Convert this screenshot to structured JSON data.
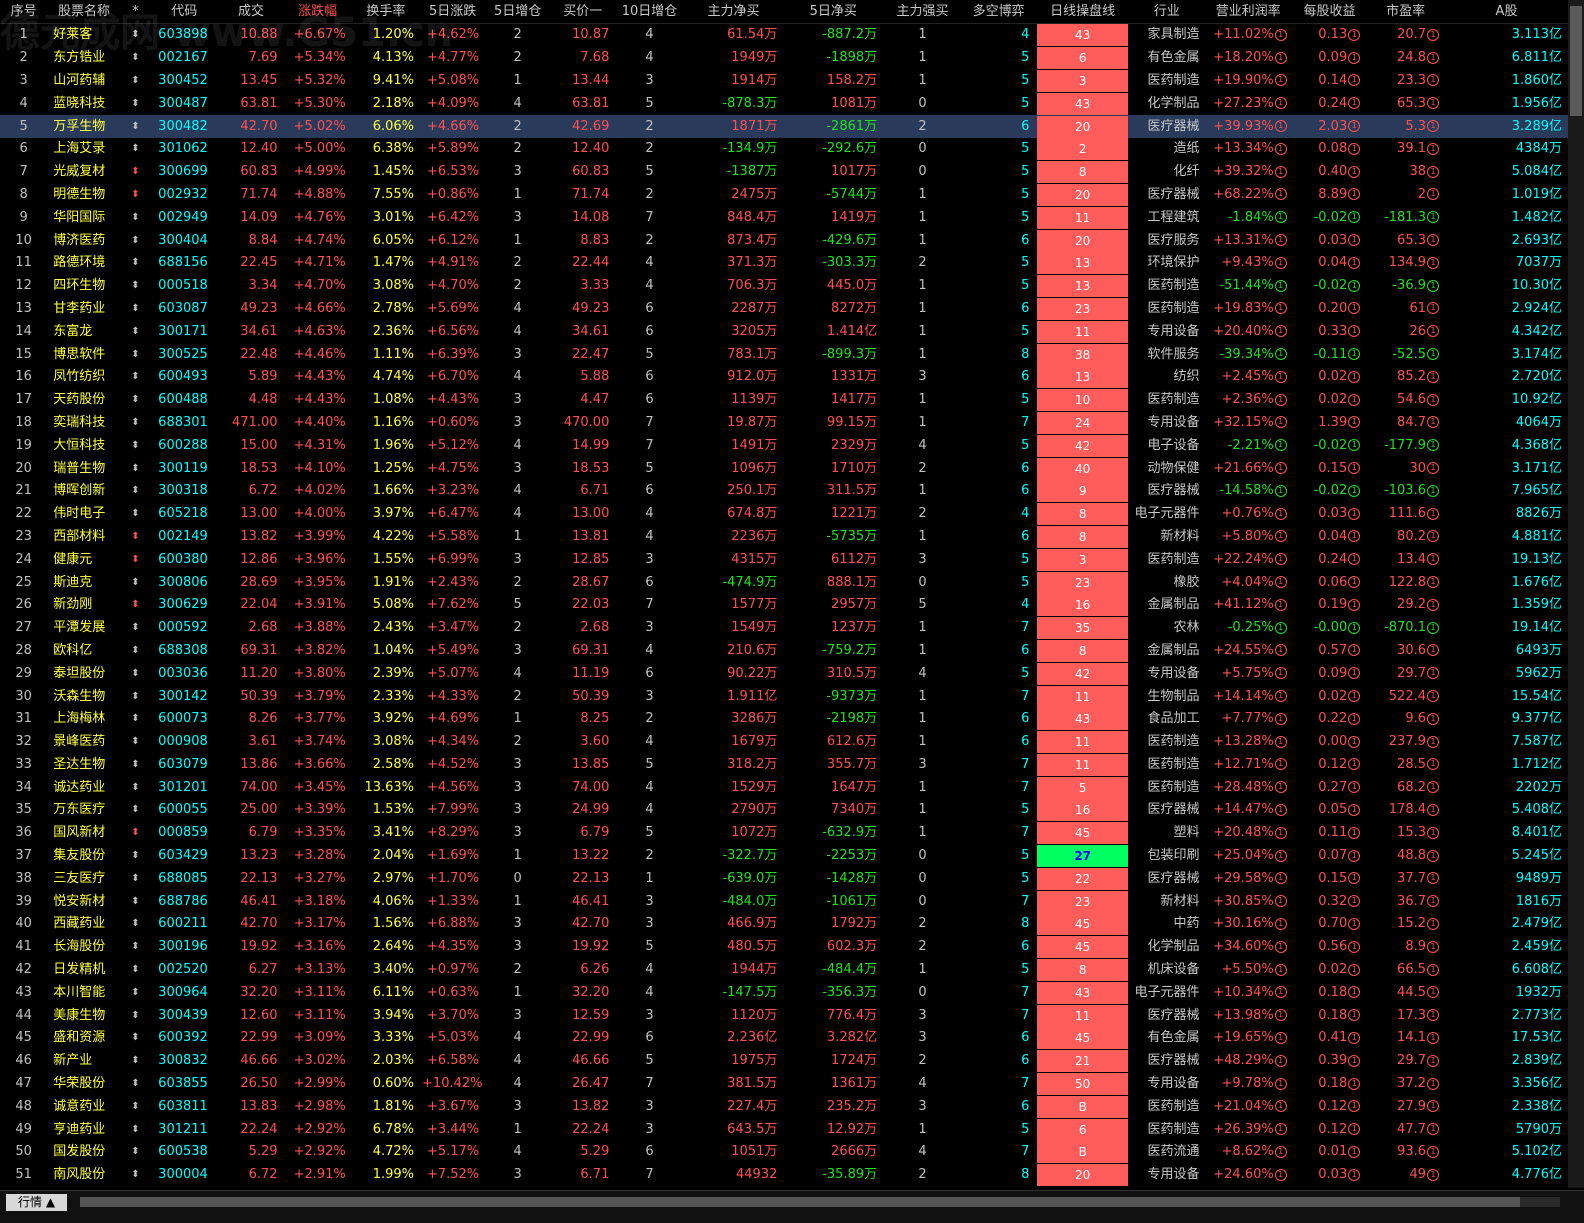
{
  "headers": [
    "序号",
    "股票名称",
    "*",
    "代码",
    "成交",
    "涨跌幅",
    "换手率",
    "5日涨跌",
    "5日增仓",
    "买价一",
    "10日增仓",
    "主力净买",
    "5日净买",
    "主力强买",
    "多空博弈",
    "日线操盘线",
    "行业",
    "营业利润率",
    "每股收益",
    "市盈率",
    "A股"
  ],
  "watermark": "德元成网 www.G51.cn",
  "bottom_tab": "行情 ▲",
  "circle_mark": "①",
  "rows": [
    [
      "1",
      "好莱客",
      "⬍",
      "603898",
      "10.88",
      "+6.67%",
      "1.20%",
      "+4.62%",
      "2",
      "10.87",
      "4",
      "61.54万",
      "-887.2万",
      "1",
      "4",
      "43",
      "家具制造",
      "+11.02%",
      "0.13",
      "20.7",
      "3.113亿"
    ],
    [
      "2",
      "东方锆业",
      "⬍",
      "002167",
      "7.69",
      "+5.34%",
      "4.13%",
      "+4.77%",
      "2",
      "7.68",
      "4",
      "1949万",
      "-1898万",
      "1",
      "5",
      "6",
      "有色金属",
      "+18.20%",
      "0.09",
      "24.8",
      "6.811亿"
    ],
    [
      "3",
      "山河药辅",
      "⬍",
      "300452",
      "13.45",
      "+5.32%",
      "9.41%",
      "+5.08%",
      "1",
      "13.44",
      "3",
      "1914万",
      "158.2万",
      "1",
      "5",
      "3",
      "医药制造",
      "+19.90%",
      "0.14",
      "23.3",
      "1.860亿"
    ],
    [
      "4",
      "蓝晓科技",
      "⬍",
      "300487",
      "63.81",
      "+5.30%",
      "2.18%",
      "+4.09%",
      "4",
      "63.81",
      "5",
      "-878.3万",
      "1081万",
      "0",
      "5",
      "43",
      "化学制品",
      "+27.23%",
      "0.24",
      "65.3",
      "1.956亿"
    ],
    [
      "5",
      "万孚生物",
      "⬍",
      "300482",
      "42.70",
      "+5.02%",
      "6.06%",
      "+4.66%",
      "2",
      "42.69",
      "2",
      "1871万",
      "-2861万",
      "2",
      "6",
      "20",
      "医疗器械",
      "+39.93%",
      "2.03",
      "5.3",
      "3.289亿"
    ],
    [
      "6",
      "上海艾录",
      "⬍",
      "301062",
      "12.40",
      "+5.00%",
      "6.38%",
      "+5.89%",
      "2",
      "12.40",
      "2",
      "-134.9万",
      "-292.6万",
      "0",
      "5",
      "2",
      "造纸",
      "+13.34%",
      "0.08",
      "39.1",
      "4384万"
    ],
    [
      "7",
      "光威复材",
      "⬍",
      "300699",
      "60.83",
      "+4.99%",
      "1.45%",
      "+6.53%",
      "3",
      "60.83",
      "5",
      "-1387万",
      "1017万",
      "0",
      "5",
      "8",
      "化纤",
      "+39.32%",
      "0.40",
      "38",
      "5.084亿"
    ],
    [
      "8",
      "明德生物",
      "⬍",
      "002932",
      "71.74",
      "+4.88%",
      "7.55%",
      "+0.86%",
      "1",
      "71.74",
      "2",
      "2475万",
      "-5744万",
      "1",
      "5",
      "20",
      "医疗器械",
      "+68.22%",
      "8.89",
      "2",
      "1.019亿"
    ],
    [
      "9",
      "华阳国际",
      "⬍",
      "002949",
      "14.09",
      "+4.76%",
      "3.01%",
      "+6.42%",
      "3",
      "14.08",
      "7",
      "848.4万",
      "1419万",
      "1",
      "5",
      "11",
      "工程建筑",
      "-1.84%",
      "-0.02",
      "-181.3",
      "1.482亿"
    ],
    [
      "10",
      "博济医药",
      "⬍",
      "300404",
      "8.84",
      "+4.74%",
      "6.05%",
      "+6.12%",
      "1",
      "8.83",
      "2",
      "873.4万",
      "-429.6万",
      "1",
      "6",
      "20",
      "医疗服务",
      "+13.31%",
      "0.03",
      "65.3",
      "2.693亿"
    ],
    [
      "11",
      "路德环境",
      "⬍",
      "688156",
      "22.45",
      "+4.71%",
      "1.47%",
      "+4.91%",
      "2",
      "22.44",
      "4",
      "371.3万",
      "-303.3万",
      "2",
      "5",
      "13",
      "环境保护",
      "+9.43%",
      "0.04",
      "134.9",
      "7037万"
    ],
    [
      "12",
      "四环生物",
      "⬍",
      "000518",
      "3.34",
      "+4.70%",
      "3.08%",
      "+4.70%",
      "2",
      "3.33",
      "4",
      "706.3万",
      "445.0万",
      "1",
      "5",
      "13",
      "医药制造",
      "-51.44%",
      "-0.02",
      "-36.9",
      "10.30亿"
    ],
    [
      "13",
      "甘李药业",
      "⬍",
      "603087",
      "49.23",
      "+4.66%",
      "2.78%",
      "+5.69%",
      "4",
      "49.23",
      "6",
      "2287万",
      "8272万",
      "1",
      "6",
      "23",
      "医药制造",
      "+19.83%",
      "0.20",
      "61",
      "2.924亿"
    ],
    [
      "14",
      "东富龙",
      "⬍",
      "300171",
      "34.61",
      "+4.63%",
      "2.36%",
      "+6.56%",
      "4",
      "34.61",
      "6",
      "3205万",
      "1.414亿",
      "1",
      "5",
      "11",
      "专用设备",
      "+20.40%",
      "0.33",
      "26",
      "4.342亿"
    ],
    [
      "15",
      "博思软件",
      "⬍",
      "300525",
      "22.48",
      "+4.46%",
      "1.11%",
      "+6.39%",
      "3",
      "22.47",
      "5",
      "783.1万",
      "-899.3万",
      "1",
      "8",
      "38",
      "软件服务",
      "-39.34%",
      "-0.11",
      "-52.5",
      "3.174亿"
    ],
    [
      "16",
      "凤竹纺织",
      "⬍",
      "600493",
      "5.89",
      "+4.43%",
      "4.74%",
      "+6.70%",
      "4",
      "5.88",
      "6",
      "912.0万",
      "1331万",
      "3",
      "6",
      "13",
      "纺织",
      "+2.45%",
      "0.02",
      "85.2",
      "2.720亿"
    ],
    [
      "17",
      "天药股份",
      "⬍",
      "600488",
      "4.48",
      "+4.43%",
      "1.08%",
      "+4.43%",
      "3",
      "4.47",
      "6",
      "1139万",
      "1417万",
      "1",
      "5",
      "10",
      "医药制造",
      "+2.36%",
      "0.02",
      "54.6",
      "10.92亿"
    ],
    [
      "18",
      "奕瑞科技",
      "⬍",
      "688301",
      "471.00",
      "+4.40%",
      "1.16%",
      "+0.60%",
      "3",
      "470.00",
      "7",
      "19.87万",
      "99.15万",
      "1",
      "7",
      "24",
      "专用设备",
      "+32.15%",
      "1.39",
      "84.7",
      "4064万"
    ],
    [
      "19",
      "大恒科技",
      "⬍",
      "600288",
      "15.00",
      "+4.31%",
      "1.96%",
      "+5.12%",
      "4",
      "14.99",
      "7",
      "1491万",
      "2329万",
      "4",
      "5",
      "42",
      "电子设备",
      "-2.21%",
      "-0.02",
      "-177.9",
      "4.368亿"
    ],
    [
      "20",
      "瑞普生物",
      "⬍",
      "300119",
      "18.53",
      "+4.10%",
      "1.25%",
      "+4.75%",
      "3",
      "18.53",
      "5",
      "1096万",
      "1710万",
      "2",
      "6",
      "40",
      "动物保健",
      "+21.66%",
      "0.15",
      "30",
      "3.171亿"
    ],
    [
      "21",
      "博晖创新",
      "⬍",
      "300318",
      "6.72",
      "+4.02%",
      "1.66%",
      "+3.23%",
      "4",
      "6.71",
      "6",
      "250.1万",
      "311.5万",
      "1",
      "6",
      "9",
      "医疗器械",
      "-14.58%",
      "-0.02",
      "-103.6",
      "7.965亿"
    ],
    [
      "22",
      "伟时电子",
      "⬍",
      "605218",
      "13.00",
      "+4.00%",
      "3.97%",
      "+6.47%",
      "4",
      "13.00",
      "4",
      "674.8万",
      "1221万",
      "2",
      "4",
      "8",
      "电子元器件",
      "+0.76%",
      "0.03",
      "111.6",
      "8826万"
    ],
    [
      "23",
      "西部材料",
      "⬍",
      "002149",
      "13.82",
      "+3.99%",
      "4.22%",
      "+5.58%",
      "1",
      "13.81",
      "4",
      "2236万",
      "-5735万",
      "1",
      "6",
      "8",
      "新材料",
      "+5.80%",
      "0.04",
      "80.2",
      "4.881亿"
    ],
    [
      "24",
      "健康元",
      "⬍",
      "600380",
      "12.86",
      "+3.96%",
      "1.55%",
      "+6.99%",
      "3",
      "12.85",
      "3",
      "4315万",
      "6112万",
      "3",
      "5",
      "3",
      "医药制造",
      "+22.24%",
      "0.24",
      "13.4",
      "19.13亿"
    ],
    [
      "25",
      "斯迪克",
      "⬍",
      "300806",
      "28.69",
      "+3.95%",
      "1.91%",
      "+2.43%",
      "2",
      "28.67",
      "6",
      "-474.9万",
      "888.1万",
      "0",
      "5",
      "23",
      "橡胶",
      "+4.04%",
      "0.06",
      "122.8",
      "1.676亿"
    ],
    [
      "26",
      "新劲刚",
      "⬍",
      "300629",
      "22.04",
      "+3.91%",
      "5.08%",
      "+7.62%",
      "5",
      "22.03",
      "7",
      "1577万",
      "2957万",
      "5",
      "4",
      "16",
      "金属制品",
      "+41.12%",
      "0.19",
      "29.2",
      "1.359亿"
    ],
    [
      "27",
      "平潭发展",
      "⬍",
      "000592",
      "2.68",
      "+3.88%",
      "2.43%",
      "+3.47%",
      "2",
      "2.68",
      "3",
      "1549万",
      "1237万",
      "1",
      "7",
      "35",
      "农林",
      "-0.25%",
      "-0.00",
      "-870.1",
      "19.14亿"
    ],
    [
      "28",
      "欧科亿",
      "⬍",
      "688308",
      "69.31",
      "+3.82%",
      "1.04%",
      "+5.49%",
      "3",
      "69.31",
      "4",
      "210.6万",
      "-759.2万",
      "1",
      "6",
      "8",
      "金属制品",
      "+24.55%",
      "0.57",
      "30.6",
      "6493万"
    ],
    [
      "29",
      "泰坦股份",
      "⬍",
      "003036",
      "11.20",
      "+3.80%",
      "2.39%",
      "+5.07%",
      "4",
      "11.19",
      "6",
      "90.22万",
      "310.5万",
      "4",
      "5",
      "42",
      "专用设备",
      "+5.75%",
      "0.09",
      "29.7",
      "5962万"
    ],
    [
      "30",
      "沃森生物",
      "⬍",
      "300142",
      "50.39",
      "+3.79%",
      "2.33%",
      "+4.33%",
      "2",
      "50.39",
      "3",
      "1.911亿",
      "-9373万",
      "1",
      "7",
      "11",
      "生物制品",
      "+14.14%",
      "0.02",
      "522.4",
      "15.54亿"
    ],
    [
      "31",
      "上海梅林",
      "⬍",
      "600073",
      "8.26",
      "+3.77%",
      "3.92%",
      "+4.69%",
      "1",
      "8.25",
      "2",
      "3286万",
      "-2198万",
      "1",
      "6",
      "43",
      "食品加工",
      "+7.77%",
      "0.22",
      "9.6",
      "9.377亿"
    ],
    [
      "32",
      "景峰医药",
      "⬍",
      "000908",
      "3.61",
      "+3.74%",
      "3.08%",
      "+4.34%",
      "2",
      "3.60",
      "4",
      "1679万",
      "612.6万",
      "1",
      "6",
      "11",
      "医药制造",
      "+13.28%",
      "0.00",
      "237.9",
      "7.587亿"
    ],
    [
      "33",
      "圣达生物",
      "⬍",
      "603079",
      "13.86",
      "+3.66%",
      "2.58%",
      "+4.52%",
      "3",
      "13.85",
      "5",
      "318.2万",
      "355.7万",
      "3",
      "7",
      "11",
      "医药制造",
      "+12.71%",
      "0.12",
      "28.5",
      "1.712亿"
    ],
    [
      "34",
      "诚达药业",
      "⬍",
      "301201",
      "74.00",
      "+3.45%",
      "13.63%",
      "+4.56%",
      "3",
      "74.00",
      "4",
      "1529万",
      "1647万",
      "1",
      "7",
      "5",
      "医药制造",
      "+28.48%",
      "0.27",
      "68.2",
      "2202万"
    ],
    [
      "35",
      "万东医疗",
      "⬍",
      "600055",
      "25.00",
      "+3.39%",
      "1.53%",
      "+7.99%",
      "3",
      "24.99",
      "4",
      "2790万",
      "7340万",
      "1",
      "5",
      "16",
      "医疗器械",
      "+14.47%",
      "0.05",
      "178.4",
      "5.408亿"
    ],
    [
      "36",
      "国风新材",
      "⬍",
      "000859",
      "6.79",
      "+3.35%",
      "3.41%",
      "+8.29%",
      "3",
      "6.79",
      "5",
      "1072万",
      "-632.9万",
      "1",
      "7",
      "45",
      "塑料",
      "+20.48%",
      "0.11",
      "15.3",
      "8.401亿"
    ],
    [
      "37",
      "集友股份",
      "⬍",
      "603429",
      "13.23",
      "+3.28%",
      "2.04%",
      "+1.69%",
      "1",
      "13.22",
      "2",
      "-322.7万",
      "-2253万",
      "0",
      "5",
      "27",
      "包装印刷",
      "+25.04%",
      "0.07",
      "48.8",
      "5.245亿"
    ],
    [
      "38",
      "三友医疗",
      "⬍",
      "688085",
      "22.13",
      "+3.27%",
      "2.97%",
      "+1.70%",
      "0",
      "22.13",
      "1",
      "-639.0万",
      "-1428万",
      "0",
      "5",
      "22",
      "医疗器械",
      "+29.58%",
      "0.15",
      "37.7",
      "9489万"
    ],
    [
      "39",
      "悦安新材",
      "⬍",
      "688786",
      "46.41",
      "+3.18%",
      "4.06%",
      "+1.33%",
      "1",
      "46.41",
      "3",
      "-484.0万",
      "-1061万",
      "0",
      "7",
      "23",
      "新材料",
      "+30.85%",
      "0.32",
      "36.7",
      "1816万"
    ],
    [
      "40",
      "西藏药业",
      "⬍",
      "600211",
      "42.70",
      "+3.17%",
      "1.56%",
      "+6.88%",
      "3",
      "42.70",
      "3",
      "466.9万",
      "1792万",
      "2",
      "8",
      "45",
      "中药",
      "+30.16%",
      "0.70",
      "15.2",
      "2.479亿"
    ],
    [
      "41",
      "长海股份",
      "⬍",
      "300196",
      "19.92",
      "+3.16%",
      "2.64%",
      "+4.35%",
      "3",
      "19.92",
      "5",
      "480.5万",
      "602.3万",
      "2",
      "6",
      "45",
      "化学制品",
      "+34.60%",
      "0.56",
      "8.9",
      "2.459亿"
    ],
    [
      "42",
      "日发精机",
      "⬍",
      "002520",
      "6.27",
      "+3.13%",
      "3.40%",
      "+0.97%",
      "2",
      "6.26",
      "4",
      "1944万",
      "-484.4万",
      "1",
      "5",
      "8",
      "机床设备",
      "+5.50%",
      "0.02",
      "66.5",
      "6.608亿"
    ],
    [
      "43",
      "本川智能",
      "⬍",
      "300964",
      "32.20",
      "+3.11%",
      "6.11%",
      "+0.63%",
      "1",
      "32.20",
      "4",
      "-147.5万",
      "-356.3万",
      "0",
      "7",
      "43",
      "电子元器件",
      "+10.34%",
      "0.18",
      "44.5",
      "1932万"
    ],
    [
      "44",
      "美康生物",
      "⬍",
      "300439",
      "12.60",
      "+3.11%",
      "3.94%",
      "+3.70%",
      "3",
      "12.59",
      "3",
      "1120万",
      "776.4万",
      "3",
      "7",
      "11",
      "医疗器械",
      "+13.98%",
      "0.18",
      "17.3",
      "2.773亿"
    ],
    [
      "45",
      "盛和资源",
      "⬍",
      "600392",
      "22.99",
      "+3.09%",
      "3.33%",
      "+5.03%",
      "4",
      "22.99",
      "6",
      "2.236亿",
      "3.282亿",
      "3",
      "6",
      "45",
      "有色金属",
      "+19.65%",
      "0.41",
      "14.1",
      "17.53亿"
    ],
    [
      "46",
      "新产业",
      "⬍",
      "300832",
      "46.66",
      "+3.02%",
      "2.03%",
      "+6.58%",
      "4",
      "46.66",
      "5",
      "1975万",
      "1724万",
      "2",
      "6",
      "21",
      "医疗器械",
      "+48.29%",
      "0.39",
      "29.7",
      "2.839亿"
    ],
    [
      "47",
      "华荣股份",
      "⬍",
      "603855",
      "26.50",
      "+2.99%",
      "0.60%",
      "+10.42%",
      "4",
      "26.47",
      "7",
      "381.5万",
      "1361万",
      "4",
      "7",
      "50",
      "专用设备",
      "+9.78%",
      "0.18",
      "37.2",
      "3.356亿"
    ],
    [
      "48",
      "诚意药业",
      "⬍",
      "603811",
      "13.83",
      "+2.98%",
      "1.81%",
      "+3.67%",
      "3",
      "13.82",
      "3",
      "227.4万",
      "235.2万",
      "3",
      "6",
      "B",
      "医药制造",
      "+21.04%",
      "0.12",
      "27.9",
      "2.338亿"
    ],
    [
      "49",
      "亨迪药业",
      "⬍",
      "301211",
      "22.24",
      "+2.92%",
      "6.78%",
      "+3.44%",
      "1",
      "22.24",
      "3",
      "643.5万",
      "12.92万",
      "1",
      "5",
      "6",
      "医药制造",
      "+26.39%",
      "0.12",
      "47.7",
      "5790万"
    ],
    [
      "50",
      "国发股份",
      "⬍",
      "600538",
      "5.29",
      "+2.92%",
      "4.72%",
      "+5.17%",
      "4",
      "5.29",
      "6",
      "1051万",
      "2666万",
      "4",
      "7",
      "B",
      "医药流通",
      "+8.62%",
      "0.01",
      "93.6",
      "5.102亿"
    ],
    [
      "51",
      "南风股份",
      "⬍",
      "300004",
      "6.72",
      "+2.91%",
      "1.99%",
      "+7.52%",
      "3",
      "6.71",
      "7",
      "44932",
      "-35.89万",
      "2",
      "8",
      "20",
      "专用设备",
      "+24.60%",
      "0.03",
      "49",
      "4.776亿"
    ]
  ]
}
